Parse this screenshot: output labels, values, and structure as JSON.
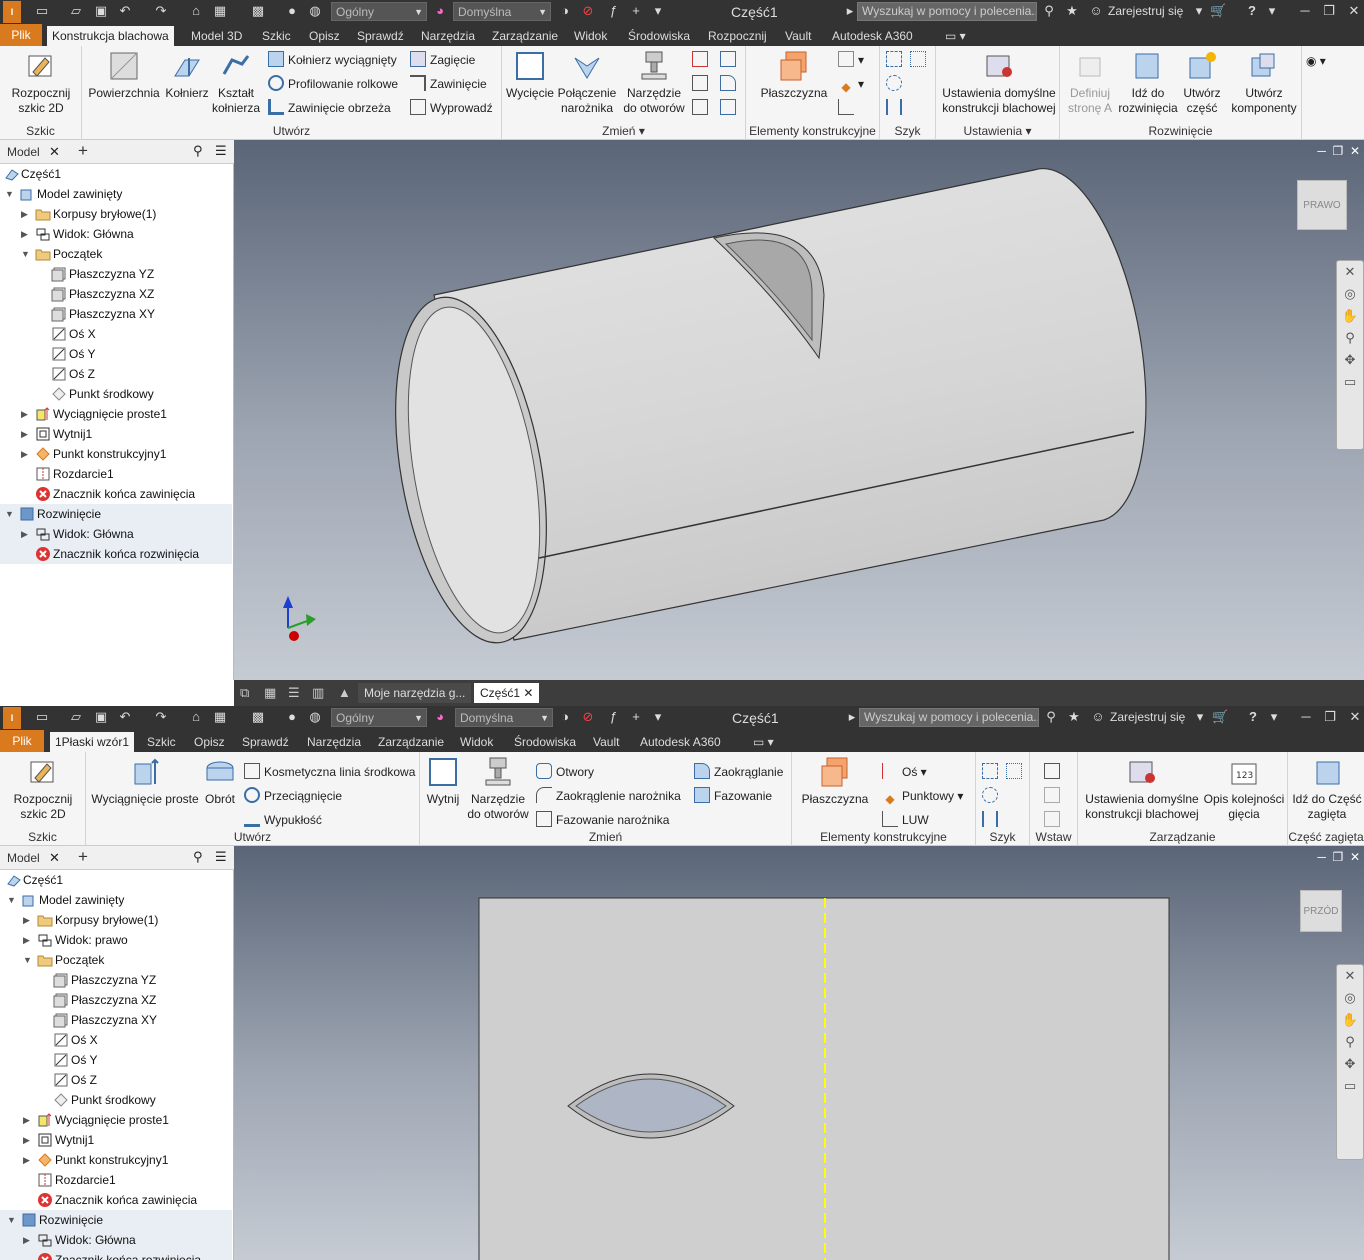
{
  "top": {
    "title": "Część1",
    "quick_style": "Ogólny",
    "appearance": "Domyślna",
    "search_placeholder": "Wyszukaj w pomocy i polecenia...",
    "signin": "Zarejestruj się",
    "help": "?",
    "tabs": [
      "Plik",
      "Konstrukcja blachowa",
      "Model 3D",
      "Szkic",
      "Opisz",
      "Sprawdź",
      "Narzędzia",
      "Zarządzanie",
      "Widok",
      "Środowiska",
      "Rozpocznij",
      "Vault",
      "Autodesk A360"
    ],
    "ribbon": {
      "szkic": {
        "label": "Szkic",
        "start_sketch": "Rozpocznij szkic 2D"
      },
      "utworz": {
        "label": "Utwórz",
        "surface": "Powierzchnia",
        "flange": "Kołnierz",
        "contour_flange": "Kształt kołnierza",
        "contour_flange2": "kołnierza",
        "flange_extruded": "Kołnierz wyciągnięty",
        "roll_form": "Profilowanie rolkowe",
        "hem": "Zawinięcie obrzeża",
        "fold": "Zagięcie",
        "bend": "Zawinięcie",
        "lofted": "Wyprowadź"
      },
      "zmien": {
        "label": "Zmień",
        "cut": "Wycięcie",
        "corner_seam": "Połączenie narożnika",
        "corner_seam2": "narożnika",
        "punch_tool": "Narzędzie do otworów",
        "punch_tool2": "do otworów"
      },
      "elementy": {
        "label": "Elementy konstrukcyjne",
        "plane": "Płaszczyzna"
      },
      "szyk": {
        "label": "Szyk"
      },
      "ustawienia": {
        "label": "Ustawienia",
        "defaults": "Ustawienia domyślne konstrukcji blachowej",
        "defaults2": "konstrukcji blachowej"
      },
      "rozwiniecie": {
        "label": "Rozwinięcie",
        "define_a": "Definiuj stronę A",
        "define_a2": "stronę A",
        "goto_flat": "Idź do rozwinięcia",
        "goto_flat2": "rozwinięcia",
        "create_part": "Utwórz część",
        "create_part2": "część",
        "create_comp": "Utwórz komponenty",
        "create_comp2": "komponenty"
      }
    },
    "browser": {
      "tab": "Model",
      "items": [
        {
          "label": "Część1",
          "level": 0
        },
        {
          "label": "Model zawinięty",
          "level": 0,
          "open": true
        },
        {
          "label": "Korpusy bryłowe(1)",
          "level": 1
        },
        {
          "label": "Widok: Główna",
          "level": 1
        },
        {
          "label": "Początek",
          "level": 1,
          "open": true
        },
        {
          "label": "Płaszczyzna YZ",
          "level": 2
        },
        {
          "label": "Płaszczyzna XZ",
          "level": 2
        },
        {
          "label": "Płaszczyzna XY",
          "level": 2
        },
        {
          "label": "Oś X",
          "level": 2
        },
        {
          "label": "Oś Y",
          "level": 2
        },
        {
          "label": "Oś Z",
          "level": 2
        },
        {
          "label": "Punkt środkowy",
          "level": 2
        },
        {
          "label": "Wyciągnięcie proste1",
          "level": 1
        },
        {
          "label": "Wytnij1",
          "level": 1
        },
        {
          "label": "Punkt konstrukcyjny1",
          "level": 1
        },
        {
          "label": "Rozdarcie1",
          "level": 1
        },
        {
          "label": "Znacznik końca zawinięcia",
          "level": 1
        },
        {
          "label": "Rozwinięcie",
          "level": 0,
          "open": true
        },
        {
          "label": "Widok: Główna",
          "level": 1
        },
        {
          "label": "Znacznik końca rozwinięcia",
          "level": 1
        }
      ]
    },
    "viewcube": "PRAWO",
    "doc_tabs": [
      "Moje narzędzia g...",
      "Część1"
    ]
  },
  "bottom": {
    "title": "Część1",
    "quick_style": "Ogólny",
    "appearance": "Domyślna",
    "search_placeholder": "Wyszukaj w pomocy i polecenia...",
    "signin": "Zarejestruj się",
    "help": "?",
    "tabs": [
      "Plik",
      "1Płaski wzór1",
      "Szkic",
      "Opisz",
      "Sprawdź",
      "Narzędzia",
      "Zarządzanie",
      "Widok",
      "Środowiska",
      "Vault",
      "Autodesk A360"
    ],
    "ribbon": {
      "szkic": {
        "label": "Szkic",
        "start_sketch": "Rozpocznij szkic 2D"
      },
      "utworz": {
        "label": "Utwórz",
        "extrude": "Wyciągnięcie proste",
        "revolve": "Obrót",
        "cosmetic": "Kosmetyczna linia środkowa",
        "sweep": "Przeciągnięcie",
        "emboss": "Wypukłość"
      },
      "zmien": {
        "label": "Zmień",
        "cut": "Wytnij",
        "punch": "Narzędzie do otworów",
        "punch2": "do otworów",
        "holes": "Otwory",
        "corner_round": "Zaokrąglenie narożnika",
        "corner_chamfer": "Fazowanie narożnika",
        "fillet": "Zaokrąglanie",
        "chamfer": "Fazowanie"
      },
      "elementy": {
        "label": "Elementy konstrukcyjne",
        "plane": "Płaszczyzna",
        "axis": "Oś",
        "point": "Punktowy",
        "ucs": "LUW"
      },
      "szyk": {
        "label": "Szyk"
      },
      "wstaw": {
        "label": "Wstaw"
      },
      "zarzadzanie": {
        "label": "Zarządzanie",
        "defaults": "Ustawienia domyślne konstrukcji blachowej",
        "defaults2": "konstrukcji blachowej",
        "bend_order": "Opis kolejności gięcia",
        "bend_order2": "gięcia"
      },
      "czesc": {
        "label": "Część zagięta",
        "goto_folded": "Idź do Część zagięta",
        "goto_folded2": "Część zagięta"
      }
    },
    "browser": {
      "tab": "Model",
      "items": [
        {
          "label": "Część1",
          "level": 0
        },
        {
          "label": "Model zawinięty",
          "level": 0,
          "open": true
        },
        {
          "label": "Korpusy bryłowe(1)",
          "level": 1
        },
        {
          "label": "Widok: prawo",
          "level": 1
        },
        {
          "label": "Początek",
          "level": 1,
          "open": true
        },
        {
          "label": "Płaszczyzna YZ",
          "level": 2
        },
        {
          "label": "Płaszczyzna XZ",
          "level": 2
        },
        {
          "label": "Płaszczyzna XY",
          "level": 2
        },
        {
          "label": "Oś X",
          "level": 2
        },
        {
          "label": "Oś Y",
          "level": 2
        },
        {
          "label": "Oś Z",
          "level": 2
        },
        {
          "label": "Punkt środkowy",
          "level": 2
        },
        {
          "label": "Wyciągnięcie proste1",
          "level": 1
        },
        {
          "label": "Wytnij1",
          "level": 1
        },
        {
          "label": "Punkt konstrukcyjny1",
          "level": 1
        },
        {
          "label": "Rozdarcie1",
          "level": 1
        },
        {
          "label": "Znacznik końca zawinięcia",
          "level": 1
        },
        {
          "label": "Rozwinięcie",
          "level": 0,
          "open": true
        },
        {
          "label": "Widok: Główna",
          "level": 1
        },
        {
          "label": "Znacznik końca rozwinięcia",
          "level": 1
        }
      ]
    },
    "viewcube": "PRZÓD"
  },
  "colors": {
    "accent": "#d97a1e",
    "titlebar": "#333333",
    "ribbon": "#f5f5f5",
    "axis_x": "#cc0000",
    "axis_y": "#2a9d2a",
    "axis_z": "#1a3fd1",
    "centerline": "#ffff00"
  }
}
